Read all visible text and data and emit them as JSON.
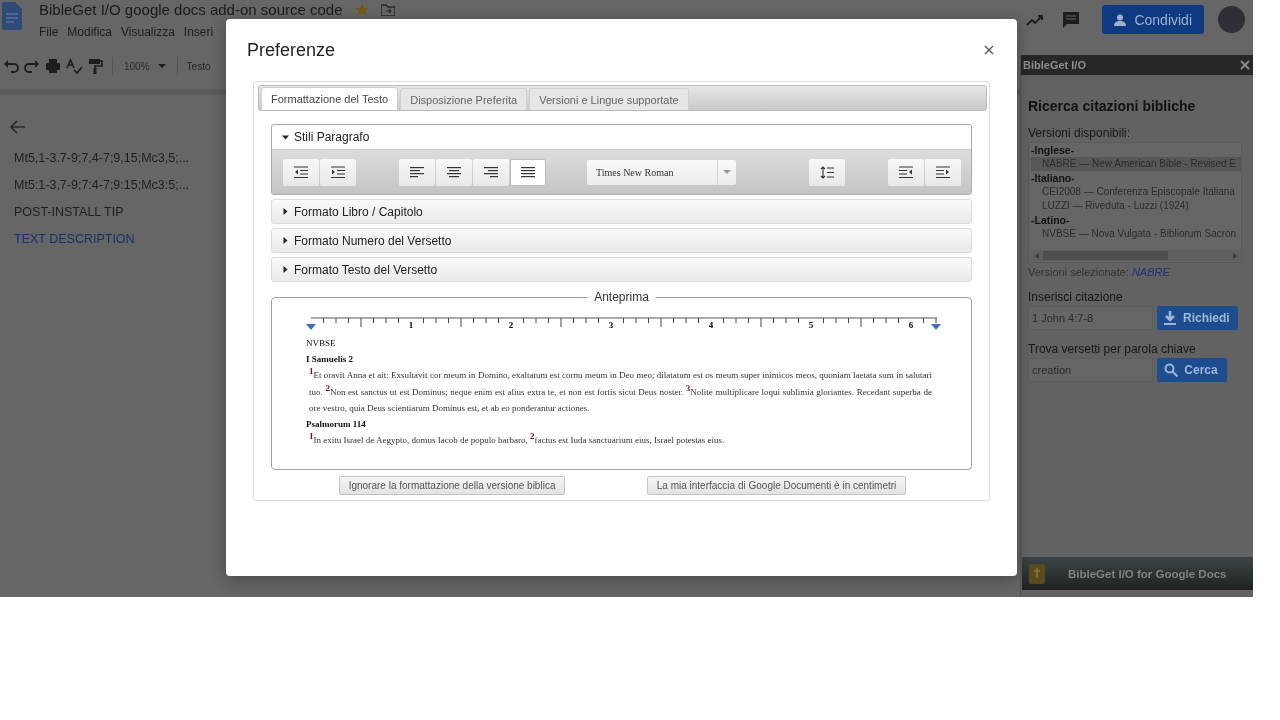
{
  "document": {
    "title": "BibleGet I/O google docs add-on source code",
    "menu": [
      "File",
      "Modifica",
      "Visualizza",
      "Inseri"
    ],
    "zoom": "100%",
    "style": "Testo",
    "share_button": "Condividi"
  },
  "outline": {
    "items": [
      {
        "text": "Mt5,1-3.7-9;7,4-7;9,15;Mc3,5;...",
        "selected": false
      },
      {
        "text": "Mt5:1-3,7-9;7:4-7;9:15;Mc3:5;...",
        "selected": false
      },
      {
        "text": "POST-INSTALL TIP",
        "selected": false
      },
      {
        "text": "TEXT DESCRIPTION",
        "selected": true
      }
    ]
  },
  "sidebar": {
    "title": "BibleGet I/O",
    "heading": "Ricerca citazioni bibliche",
    "versions_label": "Versioni disponibili:",
    "version_groups": [
      {
        "label": "-Inglese-",
        "items": [
          {
            "text": "NABRE — New American Bible - Revised E",
            "selected": true
          }
        ]
      },
      {
        "label": "-Italiano-",
        "items": [
          {
            "text": "CEI2008 — Conferenza Episcopale Italiana",
            "selected": false
          },
          {
            "text": "LUZZI — Riveduta - Luzzi (1924)",
            "selected": false
          }
        ]
      },
      {
        "label": "-Latino-",
        "items": [
          {
            "text": "NVBSE — Nova Vulgata - Bibliorum Sacron",
            "selected": false
          }
        ]
      }
    ],
    "selected_label": "Versioni selezionate:",
    "selected_value": "NABRE",
    "quote_label": "Inserisci citazione",
    "quote_value": "1 John 4:7-8",
    "quote_button": "Richiedi",
    "keyword_label": "Trova versetti per parola chiave",
    "keyword_value": "creation",
    "keyword_button": "Cerca",
    "banner": "BibleGet I/O for Google Docs"
  },
  "dialog": {
    "title": "Preferenze",
    "tabs": [
      {
        "label": "Formattazione del Testo",
        "selected": true
      },
      {
        "label": "Disposizione Preferita",
        "selected": false
      },
      {
        "label": "Versioni e Lingue supportate",
        "selected": false
      }
    ],
    "sections": [
      {
        "title": "Stili Paragrafo",
        "expanded": true
      },
      {
        "title": "Formato Libro / Capitolo",
        "expanded": false
      },
      {
        "title": "Formato Numero del Versetto",
        "expanded": false
      },
      {
        "title": "Formato Testo del Versetto",
        "expanded": false
      }
    ],
    "paragraph_toolbar": {
      "alignment": [
        {
          "kind": "left",
          "selected": false
        },
        {
          "kind": "center",
          "selected": false
        },
        {
          "kind": "right",
          "selected": false
        },
        {
          "kind": "justify",
          "selected": true
        }
      ],
      "font": "Times New Roman"
    },
    "preview": {
      "legend": "Anteprima",
      "ruler": [
        "1",
        "2",
        "3",
        "4",
        "5",
        "6"
      ],
      "version": "NVBSE",
      "books": [
        {
          "title": "I Samuelis 2",
          "text": "$^{1}$Et oravit Anna et ait: Exsultavit cor meum in Domino, exaltatum est cornu meum in Deo meo; dilatatum est os meum super inimicos meos, quoniam laetata sum in salutari tuo. $^{2}$Non est sanctus ut est Dominus; neque enim est alius extra te, et non est fortis sicut Deus noster. $^{3}$Nolite multiplicare loqui sublimia gloriantes. Recedant superba de ore vestro, quia Deus scientiarum Dominus est, et ab eo ponderantur actiones."
        },
        {
          "title": "Psalmorum 114",
          "text": "$^{1}$In exitu Israel de Aegypto, domus Iacob de populo barbaro, $^{2}$factus est Iuda sanctuarium eius, Israel potestas eius."
        }
      ]
    },
    "buttons": [
      "Ignorare la formattazione della versione biblica",
      "La mia interfaccia di Google Documenti è in centimetri"
    ]
  }
}
